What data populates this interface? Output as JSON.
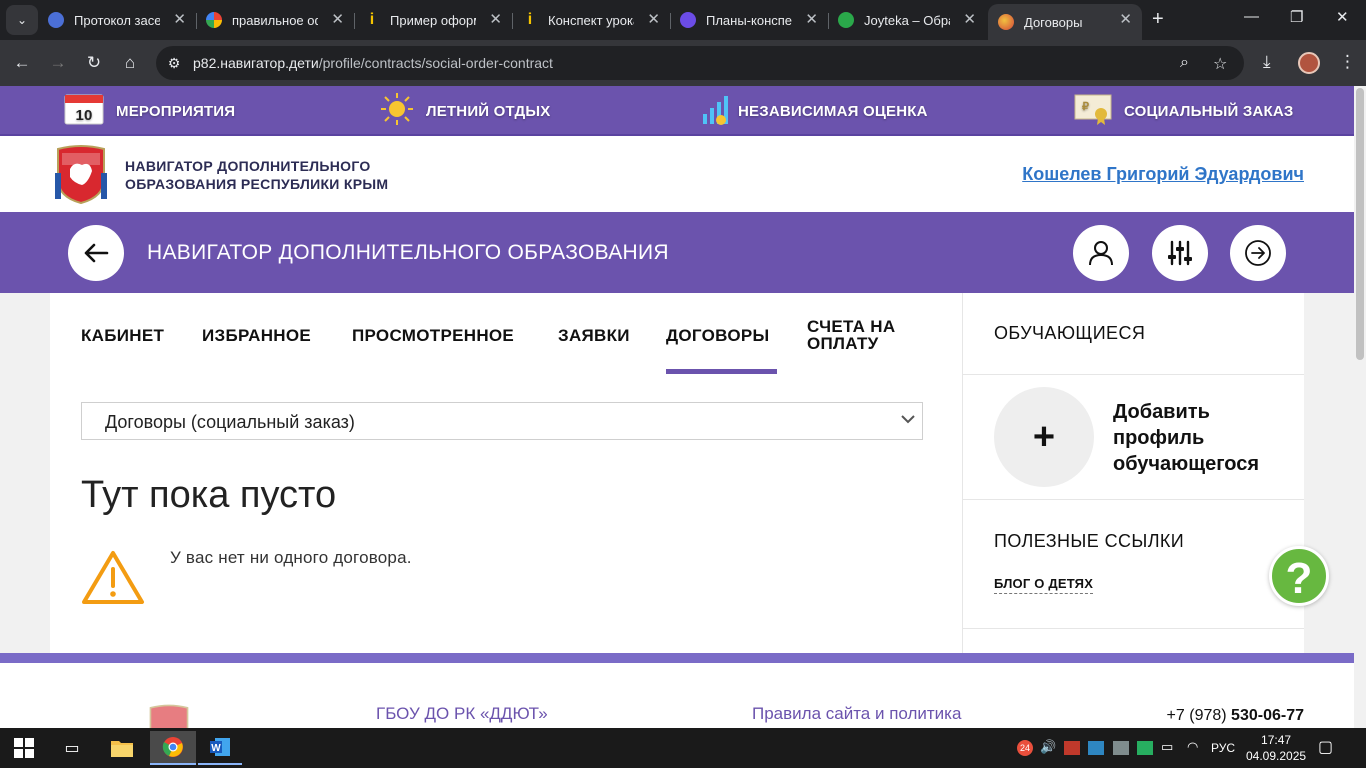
{
  "browser": {
    "tabs": [
      {
        "title": "Протокол засед",
        "color": "#4b6fd6"
      },
      {
        "title": "правильное оф",
        "color": "#ea4335"
      },
      {
        "title": "Пример оформ",
        "color": "#f5c400"
      },
      {
        "title": "Конспект урока",
        "color": "#f5c400"
      },
      {
        "title": "Планы-конспек",
        "color": "#6b4ce6"
      },
      {
        "title": "Joyteka – Обра",
        "color": "#2aa84a"
      },
      {
        "title": "Договоры",
        "color": "#d4473a"
      }
    ],
    "url_domain": "p82.навигатор.дети",
    "url_path": "/profile/contracts/social-order-contract"
  },
  "topmenu": {
    "items": [
      {
        "label": "МЕРОПРИЯТИЯ",
        "icon": "calendar-icon",
        "badge": "10"
      },
      {
        "label": "ЛЕТНИЙ ОТДЫХ",
        "icon": "sun-icon"
      },
      {
        "label": "НЕЗАВИСИМАЯ ОЦЕНКА",
        "icon": "growth-chart-icon"
      },
      {
        "label": "СОЦИАЛЬНЫЙ ЗАКАЗ",
        "icon": "certificate-icon"
      }
    ]
  },
  "header": {
    "brand_line1": "НАВИГАТОР ДОПОЛНИТЕЛЬНОГО",
    "brand_line2": "ОБРАЗОВАНИЯ РЕСПУБЛИКИ КРЫМ",
    "user": "Кошелев Григорий Эдуардович"
  },
  "band": {
    "title": "НАВИГАТОР ДОПОЛНИТЕЛЬНОГО ОБРАЗОВАНИЯ"
  },
  "profile_tabs": [
    {
      "label": "КАБИНЕТ",
      "active": false
    },
    {
      "label": "ИЗБРАННОЕ",
      "active": false
    },
    {
      "label": "ПРОСМОТРЕННОЕ",
      "active": false
    },
    {
      "label": "ЗАЯВКИ",
      "active": false
    },
    {
      "label": "ДОГОВОРЫ",
      "active": true
    },
    {
      "label": "СЧЕТА НА ОПЛАТУ",
      "active": false
    }
  ],
  "contracts": {
    "filter_value": "Договоры (социальный заказ)",
    "empty_heading": "Тут пока пусто",
    "empty_text": "У вас нет ни одного договора."
  },
  "sidebar": {
    "students_heading": "ОБУЧАЮЩИЕСЯ",
    "add_profile": "Добавить профиль обучающегося",
    "links_heading": "ПОЛЕЗНЫЕ ССЫЛКИ",
    "blog_link": "БЛОГ О ДЕТЯХ"
  },
  "footer": {
    "org": "ГБОУ ДО РК «ДДЮТ»",
    "rules": "Правила сайта и политика",
    "phone_prefix": "+7 (978)",
    "phone_number": "530-06-77"
  },
  "help_label": "?",
  "taskbar": {
    "time": "17:47",
    "date": "04.09.2025",
    "lang": "РУС",
    "notif_count": "24"
  },
  "colors": {
    "brand_purple": "#6b53ad",
    "link_blue": "#2f75c8",
    "warning_orange": "#f39c12",
    "help_green": "#67b840"
  }
}
